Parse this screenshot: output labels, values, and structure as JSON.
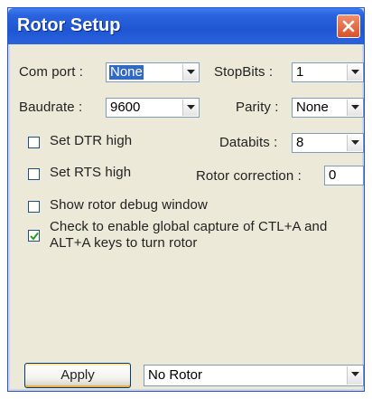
{
  "window": {
    "title": "Rotor Setup"
  },
  "fields": {
    "com_port": {
      "label": "Com port :",
      "value": "None"
    },
    "stop_bits": {
      "label": "StopBits :",
      "value": "1"
    },
    "baudrate": {
      "label": "Baudrate :",
      "value": "9600"
    },
    "parity": {
      "label": "Parity :",
      "value": "None"
    },
    "databits": {
      "label": "Databits :",
      "value": "8"
    },
    "rotor_correction": {
      "label": "Rotor correction :",
      "value": "0"
    }
  },
  "checkboxes": {
    "dtr": {
      "label": "Set DTR high",
      "checked": false
    },
    "rts": {
      "label": "Set RTS high",
      "checked": false
    },
    "debug": {
      "label": "Show rotor debug window",
      "checked": false
    },
    "capture": {
      "label_line1": "Check to enable global capture of CTL+A and",
      "label_line2": "ALT+A keys to turn rotor",
      "checked": true
    }
  },
  "footer": {
    "apply_label": "Apply",
    "rotor_value": "No Rotor"
  },
  "colors": {
    "titlebar": "#1f55d2",
    "close_button": "#d8522c",
    "dialog_background": "#ece9d8",
    "selection": "#316ac5"
  },
  "icons": {
    "close": "close-icon",
    "dropdown": "chevron-down-icon",
    "checkmark": "checkmark-icon"
  }
}
